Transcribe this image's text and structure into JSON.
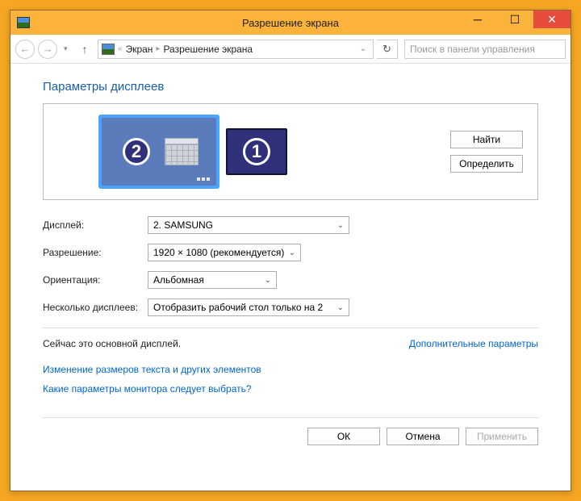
{
  "titlebar": {
    "title": "Разрешение экрана"
  },
  "toolbar": {
    "breadcrumb_prefix": "«",
    "breadcrumb1": "Экран",
    "breadcrumb2": "Разрешение экрана",
    "search_placeholder": "Поиск в панели управления"
  },
  "page": {
    "heading": "Параметры дисплеев",
    "monitors": {
      "primary_num": "2",
      "secondary_num": "1"
    },
    "find_button": "Найти",
    "identify_button": "Определить"
  },
  "form": {
    "display_label": "Дисплей:",
    "display_value": "2. SAMSUNG",
    "resolution_label": "Разрешение:",
    "resolution_value": "1920 × 1080 (рекомендуется)",
    "orientation_label": "Ориентация:",
    "orientation_value": "Альбомная",
    "multi_label": "Несколько дисплеев:",
    "multi_value": "Отобразить рабочий стол только на 2"
  },
  "info": {
    "primary_display_text": "Сейчас это основной дисплей.",
    "advanced_link": "Дополнительные параметры"
  },
  "links": {
    "text_size": "Изменение размеров текста и других элементов",
    "which_settings": "Какие параметры монитора следует выбрать?"
  },
  "actions": {
    "ok": "ОК",
    "cancel": "Отмена",
    "apply": "Применить"
  }
}
